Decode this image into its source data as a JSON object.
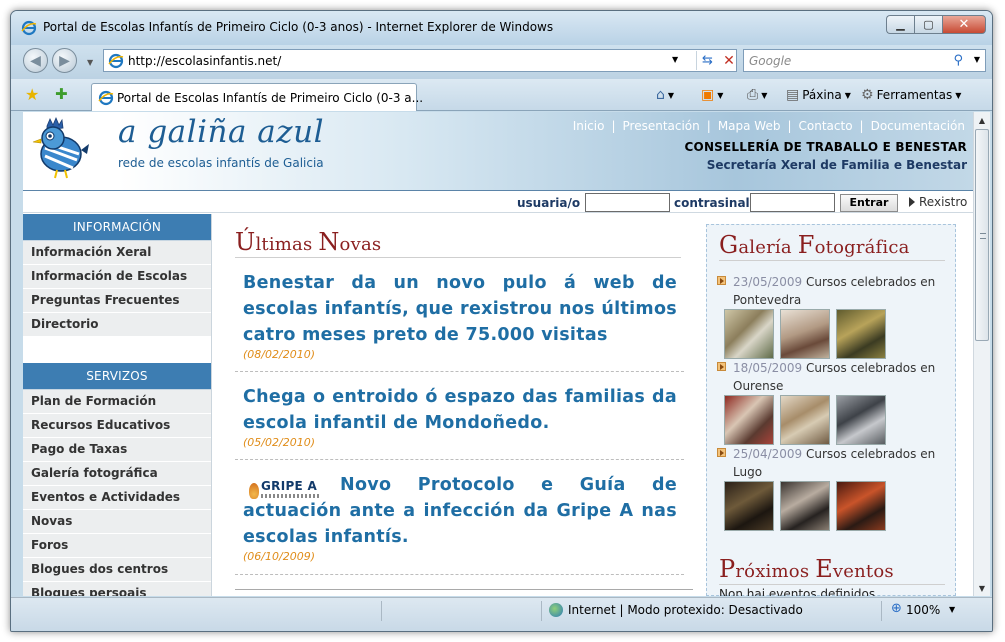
{
  "window": {
    "title": "Portal de Escolas Infantís de Primeiro Ciclo (0-3 anos) - Internet Explorer de Windows"
  },
  "address": {
    "url": "http://escolasinfantis.net/",
    "search_placeholder": "Google"
  },
  "tab": {
    "label": "Portal de Escolas Infantís de Primeiro Ciclo (0-3 a..."
  },
  "commands": {
    "page_label": "Páxina",
    "tools_label": "Ferramentas"
  },
  "site": {
    "logo_title": "a galiña azul",
    "logo_subtitle": "rede de escolas infantís de Galicia",
    "topnav": [
      "Inicio",
      "Presentación",
      "Mapa Web",
      "Contacto",
      "Documentación"
    ],
    "org_line1": "CONSELLERÍA DE TRABALLO E BENESTAR",
    "org_line2": "Secretaría Xeral de Familia e Benestar",
    "login": {
      "user_label": "usuaria/o",
      "password_label": "contrasinal",
      "submit_label": "Entrar",
      "register_label": "Rexistro"
    }
  },
  "sidebar": {
    "info_header": "INFORMACIÓN",
    "info_items": [
      "Información Xeral",
      "Información de Escolas",
      "Preguntas Frecuentes",
      "Directorio"
    ],
    "services_header": "SERVIZOS",
    "services_items": [
      "Plan de Formación",
      "Recursos Educativos",
      "Pago de Taxas",
      "Galería fotográfica",
      "Eventos e Actividades",
      "Novas",
      "Foros",
      "Blogues dos centros",
      "Blogues persoais"
    ]
  },
  "news": {
    "section_title_cap1": "Ú",
    "section_title_rest1": "ltimas ",
    "section_title_cap2": "N",
    "section_title_rest2": "ovas",
    "items": [
      {
        "title": "Benestar da un novo pulo á web de escolas infantís, que rexistrou nos últimos catro meses preto de 75.000 visitas",
        "date": "(08/02/2010)"
      },
      {
        "title": "Chega o entroido ó espazo das familias da escola infantil de Mondoñedo.",
        "date": "(05/02/2010)"
      },
      {
        "title": "Novo Protocolo e Guía de actuación ante a infección da Gripe A nas escolas infantís.",
        "date": "(06/10/2009)",
        "image_text": "GRIPE A"
      }
    ]
  },
  "gallery": {
    "title_cap1": "G",
    "title_rest1": "alería ",
    "title_cap2": "F",
    "title_rest2": "otográfica",
    "items": [
      {
        "date": "23/05/2009",
        "text": " Cursos celebrados en Pontevedra"
      },
      {
        "date": "18/05/2009",
        "text": " Cursos celebrados en Ourense"
      },
      {
        "date": "25/04/2009",
        "text": " Cursos celebrados en Lugo"
      }
    ]
  },
  "events": {
    "title_cap1": "P",
    "title_rest1": "róximos ",
    "title_cap2": "E",
    "title_rest2": "ventos",
    "empty_text": "Non hai eventos definidos"
  },
  "status": {
    "zone_text": "Internet | Modo protexido: Desactivado",
    "zoom": "100%"
  },
  "colors": {
    "accent_blue": "#3d7db2",
    "news_blue": "#1f6ea4",
    "title_red": "#8a1f1f",
    "date_orange": "#e08d1a"
  }
}
